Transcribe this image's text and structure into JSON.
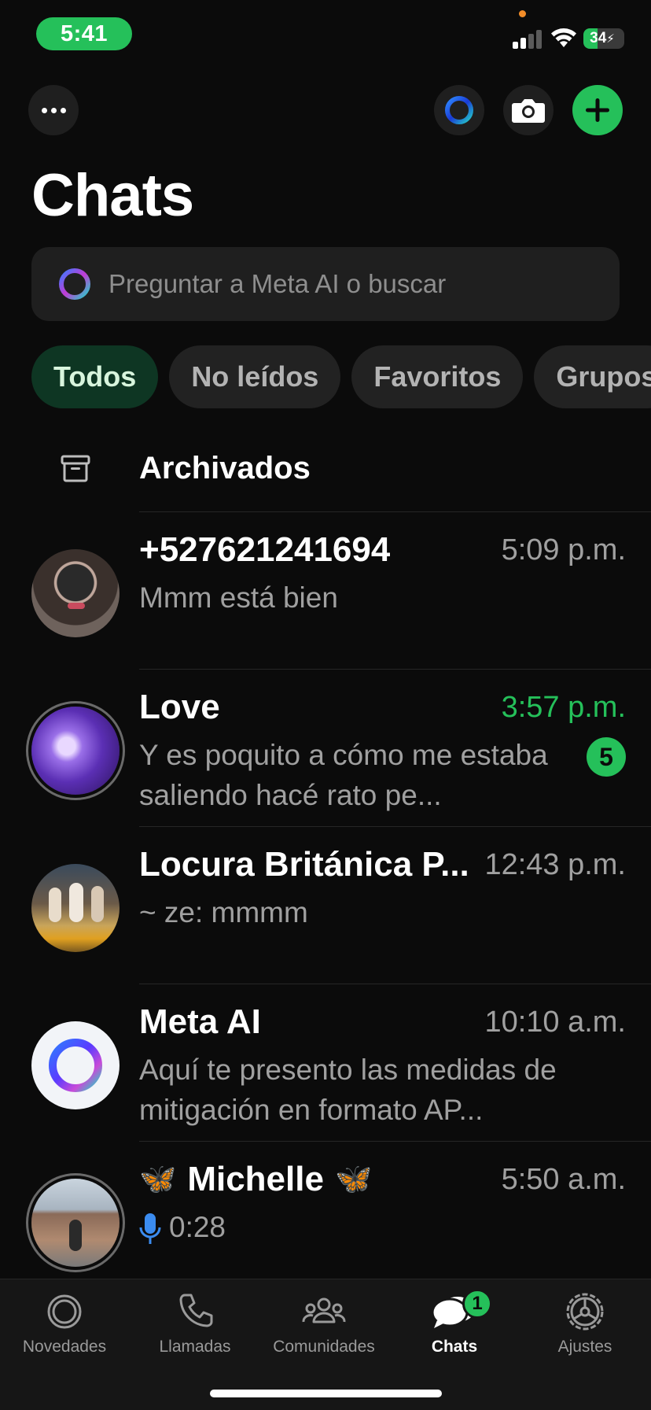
{
  "status_bar": {
    "time": "5:41",
    "battery": "34",
    "battery_level": 0.34
  },
  "header": {
    "title": "Chats"
  },
  "icons": {
    "more": "ellipsis-icon",
    "meta_ai": "meta-ai-ring-icon",
    "camera": "camera-icon",
    "new_chat": "plus-icon"
  },
  "search": {
    "placeholder": "Preguntar a Meta AI o buscar"
  },
  "filters": [
    {
      "label": "Todos",
      "active": true
    },
    {
      "label": "No leídos",
      "active": false
    },
    {
      "label": "Favoritos",
      "active": false
    },
    {
      "label": "Grupos",
      "active": false
    }
  ],
  "archived": {
    "label": "Archivados"
  },
  "chats": [
    {
      "name": "+527621241694",
      "time": "5:09 p.m.",
      "preview": "Mmm está bien",
      "unread": null,
      "time_highlight": false
    },
    {
      "name": "Love",
      "time": "3:57 p.m.",
      "preview": "Y es poquito a cómo me estaba saliendo hacé rato pe...",
      "unread": "5",
      "time_highlight": true
    },
    {
      "name": "Locura Británica P...",
      "time": "12:43 p.m.",
      "preview": "~ ze: mmmm",
      "unread": null,
      "time_highlight": false
    },
    {
      "name": "Meta AI",
      "time": "10:10 a.m.",
      "preview": "Aquí te presento las medidas de mitigación en formato AP...",
      "unread": null,
      "time_highlight": false
    },
    {
      "name": "Michelle",
      "name_emoji": "🦋",
      "time": "5:50 a.m.",
      "preview": "0:28",
      "unread": null,
      "time_highlight": false
    }
  ],
  "tabs": [
    {
      "label": "Novedades",
      "icon": "status-icon",
      "active": false
    },
    {
      "label": "Llamadas",
      "icon": "phone-icon",
      "active": false
    },
    {
      "label": "Comunidades",
      "icon": "communities-icon",
      "active": false
    },
    {
      "label": "Chats",
      "icon": "chats-icon",
      "active": true,
      "badge": "1"
    },
    {
      "label": "Ajustes",
      "icon": "settings-icon",
      "active": false
    }
  ],
  "colors": {
    "accent": "#25c05a",
    "background": "#0b0b0b",
    "chip_active_bg": "#0e3623"
  }
}
